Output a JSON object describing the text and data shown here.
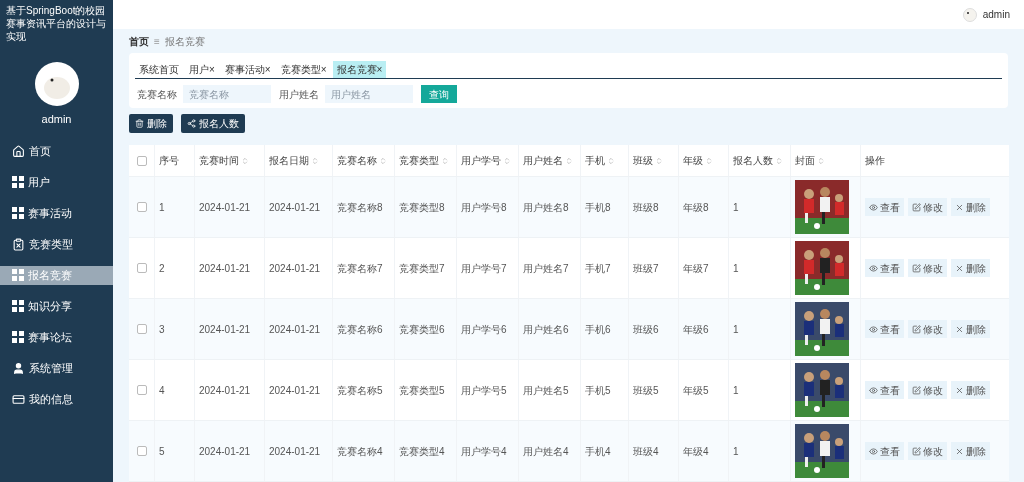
{
  "sidebar": {
    "title": "基于SpringBoot的校园赛事资讯平台的设计与实现",
    "user": "admin",
    "items": [
      {
        "label": "首页",
        "kind": "home",
        "selected": false
      },
      {
        "label": "用户",
        "kind": "grid",
        "selected": false
      },
      {
        "label": "赛事活动",
        "kind": "grid",
        "selected": false
      },
      {
        "label": "竞赛类型",
        "kind": "clipboard",
        "selected": false
      },
      {
        "label": "报名竞赛",
        "kind": "grid",
        "selected": true
      },
      {
        "label": "知识分享",
        "kind": "grid",
        "selected": false
      },
      {
        "label": "赛事论坛",
        "kind": "grid",
        "selected": false
      },
      {
        "label": "系统管理",
        "kind": "user",
        "selected": false
      },
      {
        "label": "我的信息",
        "kind": "card",
        "selected": false
      }
    ]
  },
  "header": {
    "user": "admin"
  },
  "breadcrumb": {
    "items": [
      "首页",
      "报名竞赛"
    ],
    "separator": "≡"
  },
  "tabs": [
    {
      "label": "系统首页",
      "closable": false,
      "selected": false
    },
    {
      "label": "用户",
      "closable": true,
      "selected": false
    },
    {
      "label": "赛事活动",
      "closable": true,
      "selected": false
    },
    {
      "label": "竞赛类型",
      "closable": true,
      "selected": false
    },
    {
      "label": "报名竞赛",
      "closable": true,
      "selected": true
    }
  ],
  "close_mark": "×",
  "filters": [
    {
      "label": "竞赛名称",
      "placeholder": "竞赛名称"
    },
    {
      "label": "用户姓名",
      "placeholder": "用户姓名"
    }
  ],
  "search_button": "查询",
  "actions": [
    {
      "label": "删除",
      "kind": "delete"
    },
    {
      "label": "报名人数",
      "kind": "share"
    }
  ],
  "table": {
    "select_all": {
      "checked": false
    },
    "columns": [
      {
        "label": "序号",
        "sortable": false
      },
      {
        "label": "竞赛时间",
        "sortable": true
      },
      {
        "label": "报名日期",
        "sortable": true
      },
      {
        "label": "竞赛名称",
        "sortable": true
      },
      {
        "label": "竞赛类型",
        "sortable": true
      },
      {
        "label": "用户学号",
        "sortable": true
      },
      {
        "label": "用户姓名",
        "sortable": true
      },
      {
        "label": "手机",
        "sortable": true
      },
      {
        "label": "班级",
        "sortable": true
      },
      {
        "label": "年级",
        "sortable": true
      },
      {
        "label": "报名人数",
        "sortable": true
      },
      {
        "label": "封面",
        "sortable": true
      },
      {
        "label": "操作",
        "sortable": false
      }
    ],
    "rows": [
      {
        "checked": false,
        "cells": [
          "1",
          "2024-01-21",
          "2024-01-21",
          "竞赛名称8",
          "竞赛类型8",
          "用户学号8",
          "用户姓名8",
          "手机8",
          "班级8",
          "年级8",
          "1"
        ],
        "actions": [
          {
            "label": "查看",
            "kind": "view"
          },
          {
            "label": "修改",
            "kind": "edit"
          },
          {
            "label": "删除",
            "kind": "delete"
          }
        ]
      },
      {
        "checked": false,
        "cells": [
          "2",
          "2024-01-21",
          "2024-01-21",
          "竞赛名称7",
          "竞赛类型7",
          "用户学号7",
          "用户姓名7",
          "手机7",
          "班级7",
          "年级7",
          "1"
        ],
        "actions": [
          {
            "label": "查看",
            "kind": "view"
          },
          {
            "label": "修改",
            "kind": "edit"
          },
          {
            "label": "删除",
            "kind": "delete"
          }
        ]
      },
      {
        "checked": false,
        "cells": [
          "3",
          "2024-01-21",
          "2024-01-21",
          "竞赛名称6",
          "竞赛类型6",
          "用户学号6",
          "用户姓名6",
          "手机6",
          "班级6",
          "年级6",
          "1"
        ],
        "actions": [
          {
            "label": "查看",
            "kind": "view"
          },
          {
            "label": "修改",
            "kind": "edit"
          },
          {
            "label": "删除",
            "kind": "delete"
          }
        ]
      },
      {
        "checked": false,
        "cells": [
          "4",
          "2024-01-21",
          "2024-01-21",
          "竞赛名称5",
          "竞赛类型5",
          "用户学号5",
          "用户姓名5",
          "手机5",
          "班级5",
          "年级5",
          "1"
        ],
        "actions": [
          {
            "label": "查看",
            "kind": "view"
          },
          {
            "label": "修改",
            "kind": "edit"
          },
          {
            "label": "删除",
            "kind": "delete"
          }
        ]
      },
      {
        "checked": false,
        "cells": [
          "5",
          "2024-01-21",
          "2024-01-21",
          "竞赛名称4",
          "竞赛类型4",
          "用户学号4",
          "用户姓名4",
          "手机4",
          "班级4",
          "年级4",
          "1"
        ],
        "actions": [
          {
            "label": "查看",
            "kind": "view"
          },
          {
            "label": "修改",
            "kind": "edit"
          },
          {
            "label": "删除",
            "kind": "delete"
          }
        ]
      }
    ]
  }
}
